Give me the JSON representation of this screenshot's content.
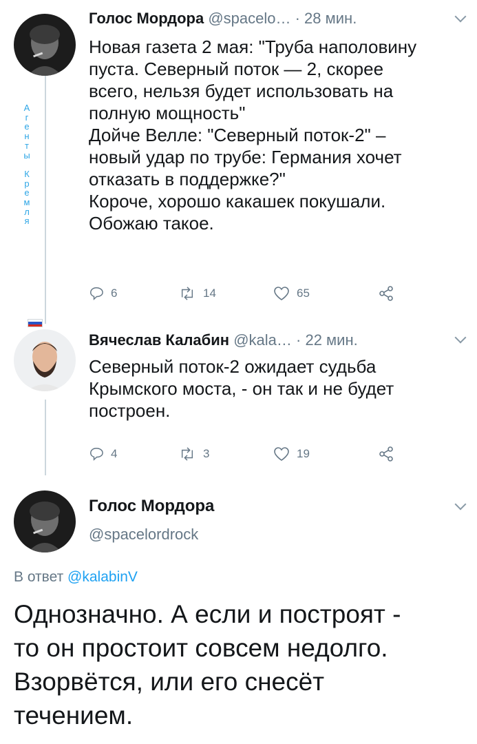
{
  "side_label": [
    "А",
    "г",
    "е",
    "н",
    "т",
    "ы",
    " ",
    "К",
    "р",
    "е",
    "м",
    "л",
    "я"
  ],
  "tweets": [
    {
      "name": "Голос Мордора",
      "handle": "@spacelo…",
      "time": "· 28 мин.",
      "lines": [
        "Новая газета 2 мая: \"Труба наполовину",
        "пуста. Северный поток — 2, скорее",
        "всего, нельзя будет использовать на",
        "полную мощность\"",
        "Дойче Велле: \"Северный поток-2\" –",
        "новый удар по трубе: Германия хочет",
        "отказать в поддержке?\"",
        "Короче, хорошо какашек покушали.",
        "Обожаю такое."
      ],
      "replies": "6",
      "retweets": "14",
      "likes": "65"
    },
    {
      "name": "Вячеслав Калабин",
      "handle": "@kala…",
      "time": "· 22 мин.",
      "lines": [
        "Северный поток-2 ожидает судьба",
        "Крымского моста, - он так и не будет",
        "построен."
      ],
      "replies": "4",
      "retweets": "3",
      "likes": "19"
    }
  ],
  "main_tweet": {
    "name": "Голос Мордора",
    "handle": "@spacelordrock",
    "reply_prefix": "В ответ",
    "reply_mention": "@kalabinV",
    "lines": [
      "Однозначно. А если и построят -",
      "то он простоит совсем недолго.",
      "Взорвётся, или его снесёт",
      "течением."
    ]
  },
  "colors": {
    "link": "#1da1f2",
    "muted": "#657786",
    "side_label": "#2ea6e6",
    "thread_line": "#ccd6dd"
  },
  "icons": [
    "reply-icon",
    "retweet-icon",
    "like-icon",
    "share-icon",
    "chevron-down-icon"
  ]
}
